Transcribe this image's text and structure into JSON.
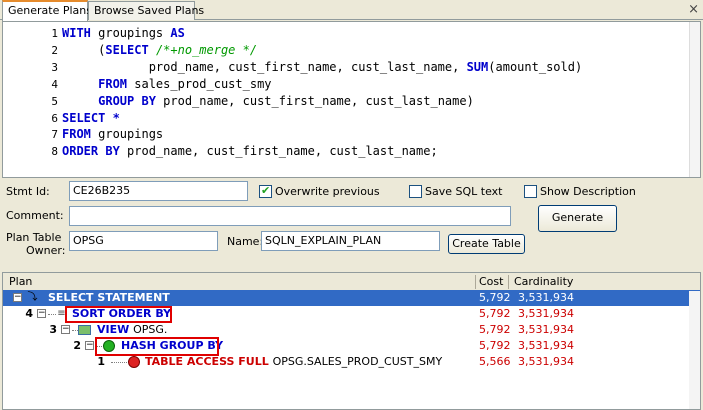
{
  "tabs": {
    "generate": "Generate Plans",
    "browse": "Browse Saved Plans",
    "close": "×"
  },
  "editor": {
    "lines": [
      {
        "n": "1",
        "parts": [
          {
            "t": "WITH ",
            "c": "kw"
          },
          {
            "t": "groupings ",
            "c": ""
          },
          {
            "t": "AS",
            "c": "kw"
          }
        ]
      },
      {
        "n": "2",
        "parts": [
          {
            "t": "     (",
            "c": ""
          },
          {
            "t": "SELECT ",
            "c": "kw"
          },
          {
            "t": "/*+no_merge */",
            "c": "cm"
          }
        ]
      },
      {
        "n": "3",
        "parts": [
          {
            "t": "            prod_name, cust_first_name, cust_last_name, ",
            "c": ""
          },
          {
            "t": "SUM",
            "c": "kw"
          },
          {
            "t": "(amount_sold)",
            "c": ""
          }
        ]
      },
      {
        "n": "4",
        "parts": [
          {
            "t": "     ",
            "c": ""
          },
          {
            "t": "FROM ",
            "c": "kw"
          },
          {
            "t": "sales_prod_cust_smy",
            "c": ""
          }
        ]
      },
      {
        "n": "5",
        "parts": [
          {
            "t": "     ",
            "c": ""
          },
          {
            "t": "GROUP BY ",
            "c": "kw"
          },
          {
            "t": "prod_name, cust_first_name, cust_last_name)",
            "c": ""
          }
        ]
      },
      {
        "n": "6",
        "parts": [
          {
            "t": "SELECT ",
            "c": "kw"
          },
          {
            "t": "*",
            "c": "kw"
          }
        ]
      },
      {
        "n": "7",
        "parts": [
          {
            "t": "FROM ",
            "c": "kw"
          },
          {
            "t": "groupings",
            "c": ""
          }
        ]
      },
      {
        "n": "8",
        "parts": [
          {
            "t": "ORDER BY ",
            "c": "kw"
          },
          {
            "t": "prod_name, cust_first_name, cust_last_name;",
            "c": ""
          }
        ]
      }
    ]
  },
  "form": {
    "stmt_id_label": "Stmt Id:",
    "stmt_id_value": "CE26B235",
    "overwrite_label": "Overwrite previous",
    "overwrite_checked": true,
    "save_sql_label": "Save SQL text",
    "save_sql_checked": false,
    "show_desc_label": "Show Description",
    "show_desc_checked": false,
    "comment_label": "Comment:",
    "comment_value": "",
    "generate_label": "Generate",
    "plan_table_label_1": "Plan Table",
    "plan_table_label_2": "Owner:",
    "owner_value": "OPSG",
    "name_label": "Name:",
    "name_value": "SQLN_EXPLAIN_PLAN",
    "create_table_label": "Create Table"
  },
  "plan": {
    "headers": {
      "plan": "Plan",
      "cost": "Cost",
      "cardinality": "Cardinality"
    },
    "rows": [
      {
        "id": "",
        "op": "SELECT STATEMENT",
        "object": "",
        "cost": "5,792",
        "card": "3,531,934"
      },
      {
        "id": "4",
        "op": "SORT ORDER BY",
        "object": "",
        "cost": "5,792",
        "card": "3,531,934"
      },
      {
        "id": "3",
        "op": "VIEW",
        "object": "OPSG.",
        "cost": "5,792",
        "card": "3,531,934"
      },
      {
        "id": "2",
        "op": "HASH GROUP BY",
        "object": "",
        "cost": "5,792",
        "card": "3,531,934"
      },
      {
        "id": "1",
        "op": "TABLE ACCESS FULL",
        "object": "OPSG.SALES_PROD_CUST_SMY",
        "cost": "5,566",
        "card": "3,531,934"
      }
    ]
  }
}
